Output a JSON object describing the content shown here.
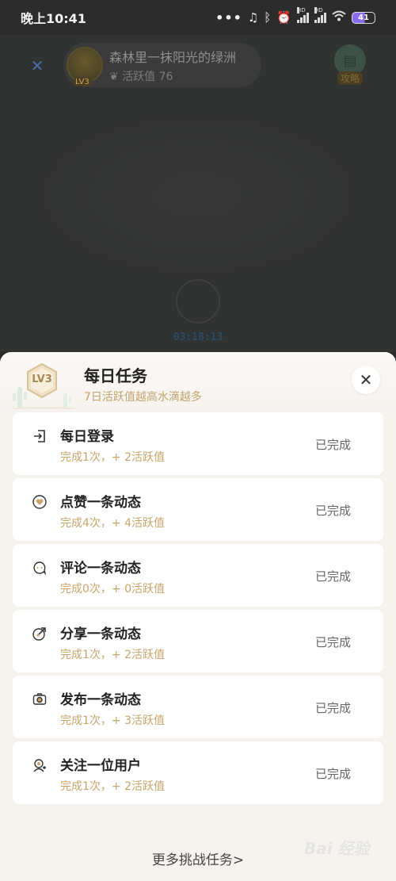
{
  "status_bar": {
    "time": "晚上10:41",
    "dots": "•••",
    "battery": "41",
    "hd": "HD"
  },
  "background_page": {
    "username": "森林里一抹阳光的绿洲",
    "activity": "活跃值 76",
    "level": "LV3",
    "guide_label": "攻略",
    "timer": "03:18:13"
  },
  "sheet": {
    "level_badge": "LV3",
    "title": "每日任务",
    "subtitle": "7日活跃值越高水滴越多",
    "close_icon": "close-icon",
    "more_tasks": "更多挑战任务>"
  },
  "tasks": [
    {
      "icon": "login-icon",
      "title": "每日登录",
      "progress": "完成1次，+ 2活跃值",
      "status": "已完成"
    },
    {
      "icon": "heart-icon",
      "title": "点赞一条动态",
      "progress": "完成4次，+ 4活跃值",
      "status": "已完成"
    },
    {
      "icon": "comment-icon",
      "title": "评论一条动态",
      "progress": "完成0次，+ 0活跃值",
      "status": "已完成"
    },
    {
      "icon": "share-icon",
      "title": "分享一条动态",
      "progress": "完成1次，+ 2活跃值",
      "status": "已完成"
    },
    {
      "icon": "camera-icon",
      "title": "发布一条动态",
      "progress": "完成1次，+ 3活跃值",
      "status": "已完成"
    },
    {
      "icon": "follow-user-icon",
      "title": "关注一位用户",
      "progress": "完成1次，+ 2活跃值",
      "status": "已完成"
    }
  ],
  "watermark": "Bai 经验",
  "colors": {
    "accent_gold": "#c9a46a",
    "sheet_bg": "#f6f3ef",
    "overlay": "#2a2b2a"
  }
}
